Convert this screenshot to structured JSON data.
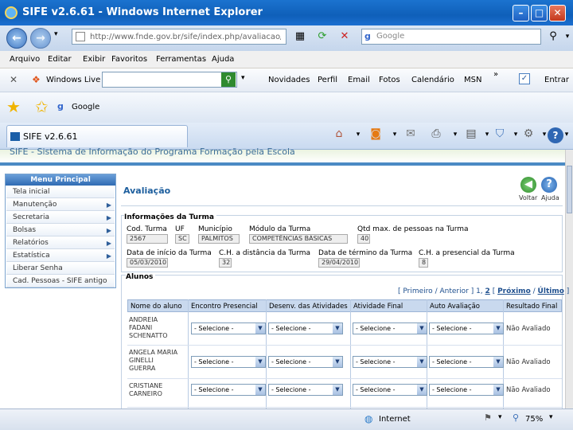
{
  "window": {
    "title": "SIFE v2.6.61 - Windows Internet Explorer"
  },
  "address": {
    "url": "http://www.fnde.gov.br/sife/index.php/avaliacao/av"
  },
  "search": {
    "placeholder": "Google"
  },
  "menus": [
    "Arquivo",
    "Editar",
    "Exibir",
    "Favoritos",
    "Ferramentas",
    "Ajuda"
  ],
  "livebar": {
    "brand": "Windows Live",
    "links": [
      "Novidades",
      "Perfil",
      "Email",
      "Fotos",
      "Calendário",
      "MSN"
    ],
    "more": "»",
    "signin": "Entrar"
  },
  "favbar": {
    "google": "Google"
  },
  "tab": {
    "title": "SIFE v2.6.61"
  },
  "site": {
    "header": "SIFE - Sistema de Informação do Programa Formação pela Escola"
  },
  "leftmenu": {
    "title": "Menu Principal",
    "items": [
      {
        "label": "Tela inicial",
        "arrow": ""
      },
      {
        "label": "Manutenção",
        "arrow": "▶"
      },
      {
        "label": "Secretaria",
        "arrow": "▶"
      },
      {
        "label": "Bolsas",
        "arrow": "▶"
      },
      {
        "label": "Relatórios",
        "arrow": "▶"
      },
      {
        "label": "Estatística",
        "arrow": "▶"
      },
      {
        "label": "Liberar Senha",
        "arrow": ""
      },
      {
        "label": "Cad. Pessoas - SIFE antigo",
        "arrow": ""
      }
    ]
  },
  "panel": {
    "title": "Avaliação",
    "voltar": "Voltar",
    "ajuda": "Ajuda",
    "info_title": "Informações da Turma",
    "fields": {
      "cod_turma": {
        "label": "Cod. Turma",
        "value": "2567"
      },
      "uf": {
        "label": "UF",
        "value": "SC"
      },
      "municipio": {
        "label": "Município",
        "value": "PALMITOS"
      },
      "modulo": {
        "label": "Módulo da Turma",
        "value": "COMPETÊNCIAS BÁSICAS"
      },
      "qtd_max": {
        "label": "Qtd max. de pessoas na Turma",
        "value": "40"
      },
      "data_inicio": {
        "label": "Data de início da Turma",
        "value": "05/03/2010"
      },
      "ch_distancia": {
        "label": "C.H. a distância da Turma",
        "value": "32"
      },
      "data_termino": {
        "label": "Data de término da Turma",
        "value": "29/04/2010"
      },
      "ch_presencial": {
        "label": "C.H. a presencial da Turma",
        "value": "8"
      }
    },
    "alunos_title": "Alunos",
    "pager": {
      "open": "[",
      "primeiro": "Primeiro",
      "sep1": "/",
      "anterior": "Anterior",
      "mid": "] 1,",
      "page2": "2",
      "sep2": "[",
      "proximo": "Próximo",
      "sep3": "/",
      "ultimo": "Último",
      "close": "]"
    },
    "columns": [
      "Nome do aluno",
      "Encontro Presencial",
      "Desenv. das Atividades",
      "Atividade Final",
      "Auto Avaliação",
      "Resultado Final"
    ],
    "select_placeholder": "- Selecione -",
    "rows": [
      {
        "name_lines": [
          "ANDREIA",
          "FADANI",
          "SCHENATTO"
        ],
        "result": "Não Avaliado"
      },
      {
        "name_lines": [
          "ANGELA MARIA",
          "GINELLI",
          "GUERRA"
        ],
        "result": "Não Avaliado"
      },
      {
        "name_lines": [
          "CRISTIANE",
          "CARNEIRO"
        ],
        "result": "Não Avaliado"
      }
    ]
  },
  "statusbar": {
    "zone": "Internet",
    "zoom": "75%"
  }
}
